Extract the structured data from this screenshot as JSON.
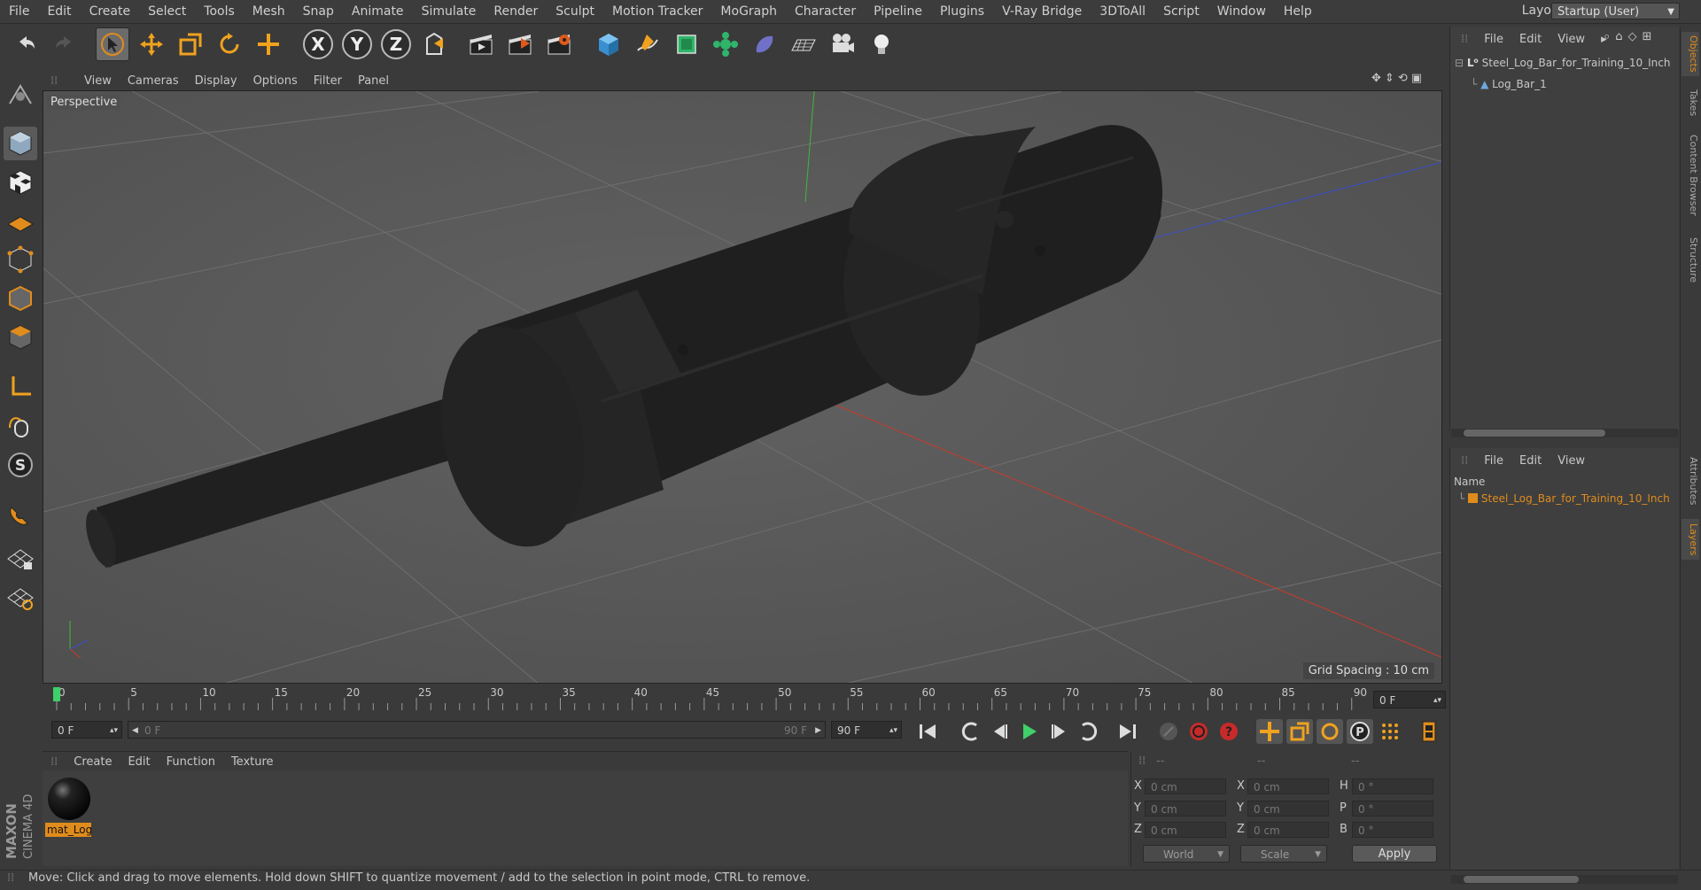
{
  "menu": {
    "items": [
      "File",
      "Edit",
      "Create",
      "Select",
      "Tools",
      "Mesh",
      "Snap",
      "Animate",
      "Simulate",
      "Render",
      "Sculpt",
      "Motion Tracker",
      "MoGraph",
      "Character",
      "Pipeline",
      "Plugins",
      "V-Ray Bridge",
      "3DToAll",
      "Script",
      "Window",
      "Help"
    ],
    "layout_label": "Layout:",
    "layout_value": "Startup (User)"
  },
  "viewport": {
    "menu": [
      "View",
      "Cameras",
      "Display",
      "Options",
      "Filter",
      "Panel"
    ],
    "camera_label": "Perspective",
    "grid_spacing": "Grid Spacing : 10 cm"
  },
  "timeline": {
    "ticks": [
      0,
      5,
      10,
      15,
      20,
      25,
      30,
      35,
      40,
      45,
      50,
      55,
      60,
      65,
      70,
      75,
      80,
      85,
      90
    ],
    "current_frame_box": "0 F",
    "start_field": "0 F",
    "range_start": "0 F",
    "range_end": "90 F",
    "end_field": "90 F"
  },
  "material_manager": {
    "menu": [
      "Create",
      "Edit",
      "Function",
      "Texture"
    ],
    "material_name": "mat_Log"
  },
  "coordinates": {
    "header_left": "--",
    "header_mid": "--",
    "header_right": "--",
    "rows": [
      {
        "a": "X",
        "av": "0 cm",
        "b": "X",
        "bv": "0 cm",
        "c": "H",
        "cv": "0 °"
      },
      {
        "a": "Y",
        "av": "0 cm",
        "b": "Y",
        "bv": "0 cm",
        "c": "P",
        "cv": "0 °"
      },
      {
        "a": "Z",
        "av": "0 cm",
        "b": "Z",
        "bv": "0 cm",
        "c": "B",
        "cv": "0 °"
      }
    ],
    "mode_world": "World",
    "mode_scale": "Scale",
    "apply": "Apply"
  },
  "status": "Move: Click and drag to move elements. Hold down SHIFT to quantize movement / add to the selection in point mode, CTRL to remove.",
  "objects_panel": {
    "menu": [
      "File",
      "Edit",
      "View"
    ],
    "items": [
      "Steel_Log_Bar_for_Training_10_Inch",
      "Log_Bar_1"
    ]
  },
  "layers_panel": {
    "menu": [
      "File",
      "Edit",
      "View"
    ],
    "column": "Name",
    "items": [
      "Steel_Log_Bar_for_Training_10_Inch"
    ]
  },
  "side_tabs": [
    "Objects",
    "Takes",
    "Content Browser",
    "Structure",
    "Attributes",
    "Layers"
  ],
  "logo": {
    "line1": "MAXON",
    "line2": "CINEMA 4D"
  },
  "colors": {
    "accent": "#e08c1c",
    "timeline_marker": "#3fd06a"
  }
}
